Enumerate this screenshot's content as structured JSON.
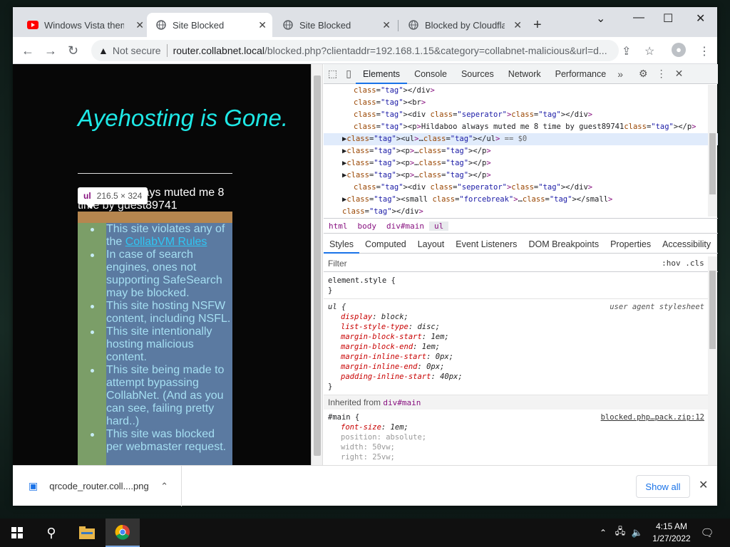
{
  "browser": {
    "tabs": [
      {
        "title": "Windows Vista theme",
        "icon": "youtube-icon"
      },
      {
        "title": "Site Blocked",
        "icon": "globe-icon"
      },
      {
        "title": "Site Blocked",
        "icon": "globe-icon"
      },
      {
        "title": "Blocked by Cloudflare",
        "icon": "globe-icon"
      }
    ],
    "security_label": "Not secure",
    "url_host": "router.collabnet.local",
    "url_rest": "/blocked.php?clientaddr=192.168.1.15&category=collabnet-malicious&url=d..."
  },
  "page": {
    "heading": "Ayehosting is Gone.",
    "muted_text": "Hildaboo always muted me 8 time by guest89741",
    "tooltip_tag": "ul",
    "tooltip_size": "216.5 × 324",
    "list": [
      {
        "pre": "This site violates any of the ",
        "link": "CollabVM Rules",
        "post": ""
      },
      {
        "pre": "In case of search engines, ones not supporting SafeSearch may be blocked.",
        "link": "",
        "post": ""
      },
      {
        "pre": "This site hosting NSFW content, including NSFL.",
        "link": "",
        "post": ""
      },
      {
        "pre": "This site intentionally hosting malicious content.",
        "link": "",
        "post": ""
      },
      {
        "pre": "This site being made to attempt bypassing CollabNet. (And as you can see, failing pretty hard..)",
        "link": "",
        "post": ""
      },
      {
        "pre": "This site was blocked per webmaster request.",
        "link": "",
        "post": ""
      }
    ]
  },
  "devtools": {
    "tabs": [
      "Elements",
      "Console",
      "Sources",
      "Network",
      "Performance"
    ],
    "dom_lines": [
      {
        "indent": 3,
        "html": "</div>"
      },
      {
        "indent": 3,
        "html": "<br>"
      },
      {
        "indent": 3,
        "html": "<div class=\"seperator\"></div>"
      },
      {
        "indent": 3,
        "html": "<p>Hildaboo always muted me 8 time by guest89741</p>"
      },
      {
        "indent": 2,
        "html": "▶<ul>…</ul> == $0",
        "selected": true
      },
      {
        "indent": 2,
        "html": "▶<p>…</p>"
      },
      {
        "indent": 2,
        "html": "▶<p>…</p>"
      },
      {
        "indent": 2,
        "html": "▶<p>…</p>"
      },
      {
        "indent": 3,
        "html": "<div class=\"seperator\"></div>"
      },
      {
        "indent": 2,
        "html": "▶<small class=\"forcebreak\">…</small>"
      },
      {
        "indent": 2,
        "html": "</div>"
      }
    ],
    "breadcrumbs": [
      "html",
      "body",
      "div#main",
      "ul"
    ],
    "style_tabs": [
      "Styles",
      "Computed",
      "Layout",
      "Event Listeners",
      "DOM Breakpoints",
      "Properties",
      "Accessibility"
    ],
    "filter_placeholder": "Filter",
    "filter_tools": ":hov  .cls  +",
    "element_style": "element.style {",
    "ul_selector": "ul {",
    "ul_source": "user agent stylesheet",
    "ul_props": [
      {
        "p": "display",
        "v": "block;"
      },
      {
        "p": "list-style-type",
        "v": "disc;"
      },
      {
        "p": "margin-block-start",
        "v": "1em;"
      },
      {
        "p": "margin-block-end",
        "v": "1em;"
      },
      {
        "p": "margin-inline-start",
        "v": "0px;"
      },
      {
        "p": "margin-inline-end",
        "v": "0px;"
      },
      {
        "p": "padding-inline-start",
        "v": "40px;"
      }
    ],
    "inherited_label": "Inherited from",
    "inherited_from": "div#main",
    "main_selector": "#main {",
    "main_source": "blocked.php…pack.zip:12",
    "main_props": [
      {
        "p": "font-size",
        "v": "1em;",
        "dim": false
      },
      {
        "p": "position",
        "v": "absolute;",
        "dim": true
      },
      {
        "p": "width",
        "v": "50vw;",
        "dim": true
      },
      {
        "p": "right",
        "v": "25vw;",
        "dim": true
      }
    ]
  },
  "downloads": {
    "file": "qrcode_router.coll....png",
    "show_all": "Show all"
  },
  "taskbar": {
    "time": "4:15 AM",
    "date": "1/27/2022"
  }
}
